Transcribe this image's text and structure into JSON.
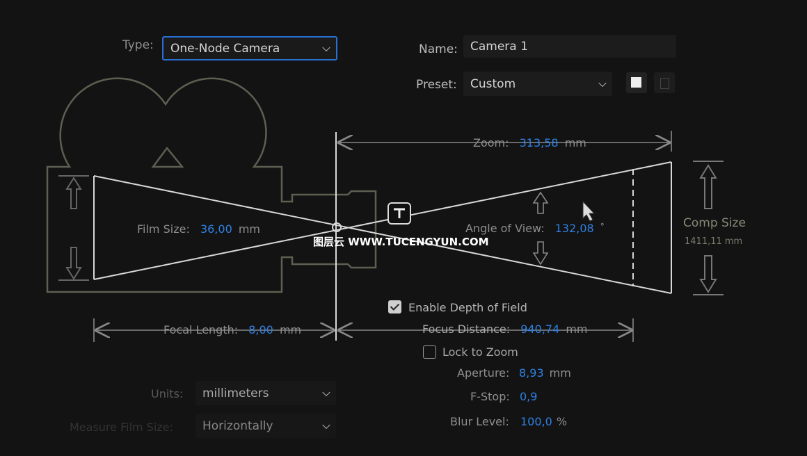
{
  "type": {
    "label": "Type:",
    "value": "One-Node Camera"
  },
  "name": {
    "label": "Name:",
    "value": "Camera 1"
  },
  "preset": {
    "label": "Preset:",
    "value": "Custom",
    "new_icon": "new-preset-icon",
    "delete_icon": "trash-icon"
  },
  "zoom": {
    "label": "Zoom:",
    "value": "313,58",
    "unit": "mm"
  },
  "film_size": {
    "label": "Film Size:",
    "value": "36,00",
    "unit": "mm"
  },
  "angle_of_view": {
    "label": "Angle of View:",
    "value": "132,08",
    "unit": "°"
  },
  "comp_size": {
    "label": "Comp Size",
    "value": "1411,11 mm"
  },
  "depth_of_field": {
    "label": "Enable Depth of Field",
    "checked": true
  },
  "focal_length": {
    "label": "Focal Length:",
    "value": "8,00",
    "unit": "mm"
  },
  "focus_distance": {
    "label": "Focus Distance:",
    "value": "940,74",
    "unit": "mm"
  },
  "lock_to_zoom": {
    "label": "Lock to Zoom",
    "checked": false
  },
  "aperture": {
    "label": "Aperture:",
    "value": "8,93",
    "unit": "mm"
  },
  "f_stop": {
    "label": "F-Stop:",
    "value": "0,9"
  },
  "blur_level": {
    "label": "Blur Level:",
    "value": "100,0",
    "unit": "%"
  },
  "units": {
    "label": "Units:",
    "value": "millimeters"
  },
  "measure_film_size": {
    "label": "Measure Film Size:",
    "value": "Horizontally"
  },
  "watermark": "图层云 WWW.TUCENGYUN.COM",
  "colors": {
    "accent": "#2f80e3",
    "background": "#131313",
    "focus_border": "#2a6fd6"
  }
}
